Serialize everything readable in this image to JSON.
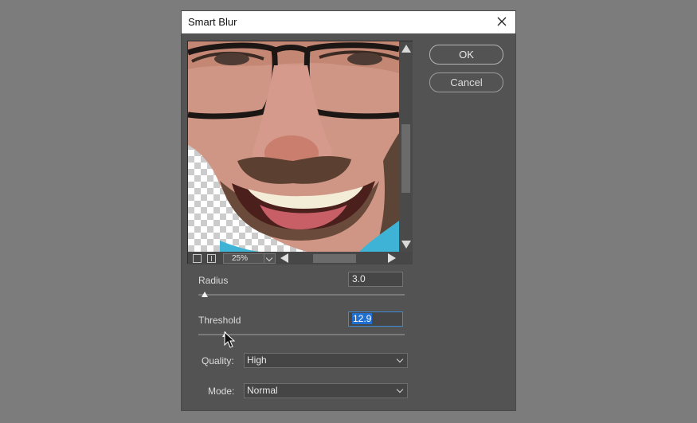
{
  "dialog": {
    "title": "Smart Blur",
    "ok_label": "OK",
    "cancel_label": "Cancel"
  },
  "preview": {
    "zoom": "25%"
  },
  "radius": {
    "label": "Radius",
    "value": "3.0"
  },
  "threshold": {
    "label": "Threshold",
    "value": "12.9"
  },
  "quality": {
    "label": "Quality:",
    "value": "High"
  },
  "mode": {
    "label": "Mode:",
    "value": "Normal"
  },
  "icons": {
    "close": "close-icon",
    "scroll_up": "arrow-up-icon",
    "scroll_down": "arrow-down-icon",
    "scroll_left": "arrow-left-icon",
    "scroll_right": "arrow-right-icon",
    "dropdown": "chevron-down-icon",
    "cursor": "mouse-pointer-icon"
  },
  "colors": {
    "dialog_bg": "#535353",
    "screen_bg": "#7c7c7c",
    "focus_border": "#3d8bd8",
    "selection": "#1f6fd1"
  }
}
